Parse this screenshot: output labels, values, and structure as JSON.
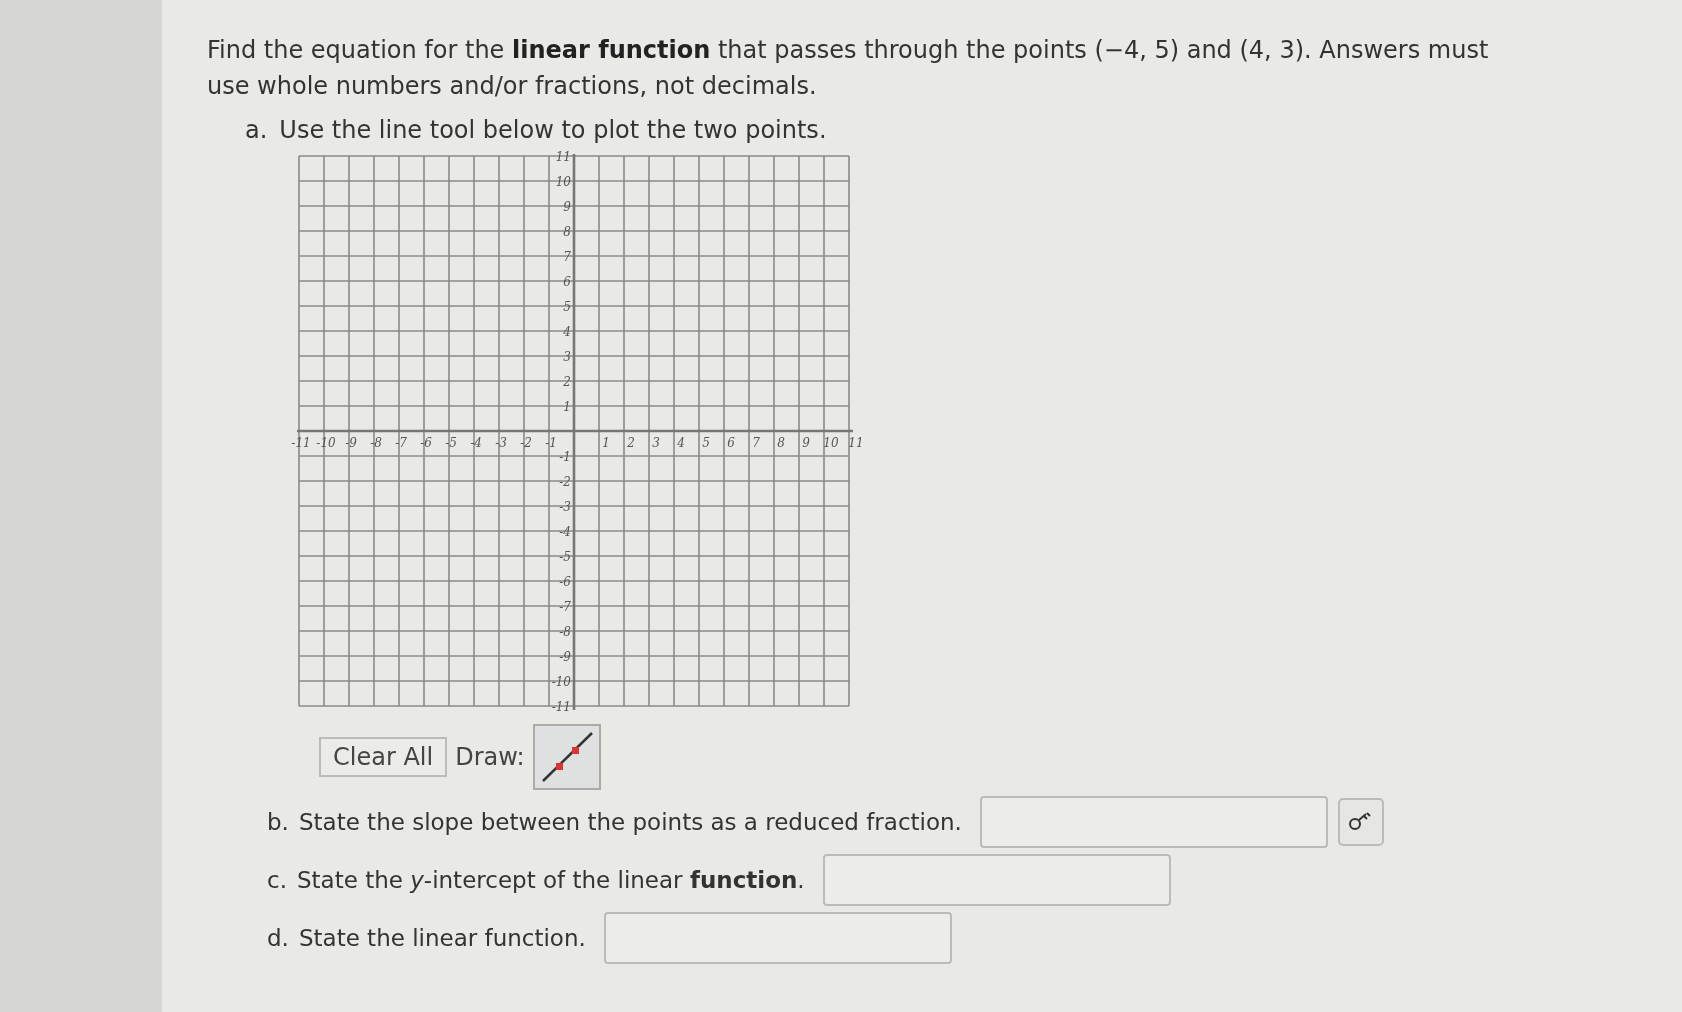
{
  "question": "Find the equation for the **linear function** that passes through the points (−4, 5) and (4, 3). Answers must use whole numbers and/or fractions, not decimals.",
  "part_a": {
    "marker": "a.",
    "prompt": "Use the line tool below to plot the two points.",
    "graph": {
      "x_tick_labels": [
        "-11",
        "-10",
        "-9",
        "-8",
        "-7",
        "-6",
        "-5",
        "-4",
        "-3",
        "-2",
        "-1",
        "1",
        "2",
        "3",
        "4",
        "5",
        "6",
        "7",
        "8",
        "9",
        "10",
        "11"
      ],
      "y_tick_labels": [
        "11",
        "10",
        "9",
        "8",
        "7",
        "6",
        "5",
        "4",
        "3",
        "2",
        "1",
        "-1",
        "-2",
        "-3",
        "-4",
        "-5",
        "-6",
        "-7",
        "-8",
        "-9",
        "-10",
        "-11"
      ]
    },
    "clear_button": "Clear All",
    "draw_label": "Draw:"
  },
  "parts": [
    {
      "marker": "b.",
      "prompt": "State the slope between the points as a reduced fraction.",
      "has_key": true
    },
    {
      "marker": "c.",
      "prompt": "State the *y*-intercept of the linear **function**.",
      "has_key": false
    },
    {
      "marker": "d.",
      "prompt": "State the linear function.",
      "has_key": false
    }
  ]
}
